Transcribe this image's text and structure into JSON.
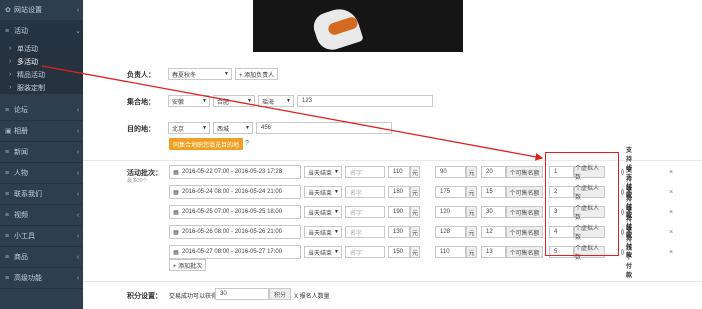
{
  "sidebar": {
    "items": [
      {
        "label": "网站设置",
        "icon": "gear-icon",
        "glyph": "✿",
        "expanded": false
      },
      {
        "label": "活动",
        "icon": "list-icon",
        "glyph": "≡",
        "expanded": true
      },
      {
        "label": "论坛",
        "icon": "list-icon",
        "glyph": "≡",
        "expanded": false
      },
      {
        "label": "相册",
        "icon": "image-icon",
        "glyph": "▣",
        "expanded": false
      },
      {
        "label": "新闻",
        "icon": "list-icon",
        "glyph": "≡",
        "expanded": false
      },
      {
        "label": "人物",
        "icon": "list-icon",
        "glyph": "≡",
        "expanded": false
      },
      {
        "label": "联系我们",
        "icon": "list-icon",
        "glyph": "≡",
        "expanded": false
      },
      {
        "label": "视频",
        "icon": "list-icon",
        "glyph": "≡",
        "expanded": false
      },
      {
        "label": "小工具",
        "icon": "list-icon",
        "glyph": "≡",
        "expanded": false
      },
      {
        "label": "商品",
        "icon": "list-icon",
        "glyph": "≡",
        "expanded": false
      },
      {
        "label": "高级功能",
        "icon": "list-icon",
        "glyph": "≡",
        "expanded": false
      }
    ],
    "sub_items": [
      {
        "label": "单活动"
      },
      {
        "label": "多活动"
      },
      {
        "label": "精品活动"
      },
      {
        "label": "服装定制"
      }
    ]
  },
  "form": {
    "manager": {
      "label": "负责人：",
      "value": "春夏秋冬",
      "add_button": "+ 添加负责人"
    },
    "meeting": {
      "label": "集合地：",
      "province": "安徽",
      "city": "合肥",
      "district": "瑶海",
      "address": "123"
    },
    "destination": {
      "label": "目的地：",
      "province": "北京",
      "district": "西城",
      "address": "456",
      "button": "同集合地职您填充目的地",
      "help": "?"
    },
    "batches": {
      "label": "活动批次：",
      "sublabel": "最多30个",
      "end_label": "当天结束",
      "name_placeholder": "名字",
      "yuan": "元",
      "sell_addon": "个可售名额",
      "virtual_addon": "个虚拟人数",
      "offline_label": "支持线下付款",
      "delete": "×",
      "rows": [
        {
          "dates": "2016-05-22 07:00 - 2016-05-23 17:28",
          "price": "110",
          "price2": "90",
          "quota": "20",
          "virtual": "1"
        },
        {
          "dates": "2016-05-24 08:00 - 2016-05-24 21:00",
          "price": "180",
          "price2": "175",
          "quota": "15",
          "virtual": "2"
        },
        {
          "dates": "2016-05-25 07:00 - 2016-05-25 18:00",
          "price": "190",
          "price2": "120",
          "quota": "30",
          "virtual": "3"
        },
        {
          "dates": "2016-05-26 08:00 - 2016-05-26 21:00",
          "price": "130",
          "price2": "128",
          "quota": "12",
          "virtual": "4"
        },
        {
          "dates": "2016-05-27 08:00 - 2016-05-27 17:00",
          "price": "150",
          "price2": "110",
          "quota": "13",
          "virtual": "5"
        }
      ],
      "add_button": "+ 添加批次"
    },
    "points": {
      "label": "积分设置：",
      "prefix": "交易成功可以获得",
      "value": "30",
      "unit": "积分",
      "suffix": "X 报名人数量"
    }
  },
  "colors": {
    "sidebar_bg": "#2f3e4c",
    "highlight": "#e02020",
    "orange": "#f0a020"
  }
}
